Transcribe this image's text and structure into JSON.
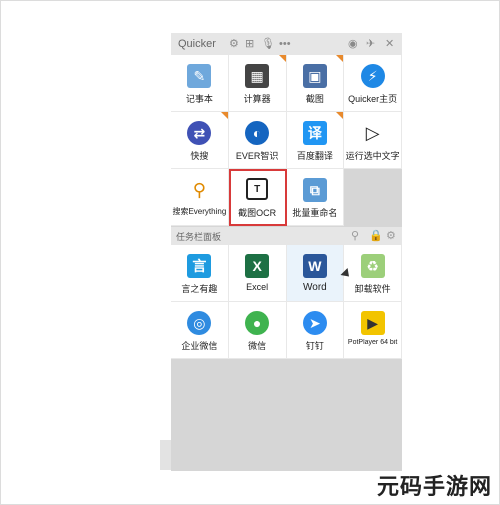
{
  "window": {
    "title": "Quicker",
    "icons": [
      "gear-icon",
      "grid-icon",
      "mic-icon",
      "more-icon",
      "account-icon",
      "pin-icon",
      "close-icon"
    ]
  },
  "actions": [
    {
      "label": "记事本",
      "icon": "notepad-icon",
      "color": "#6fa8dc",
      "corner": false
    },
    {
      "label": "计算器",
      "icon": "calculator-icon",
      "color": "#444444",
      "corner": true
    },
    {
      "label": "截图",
      "icon": "screenshot-icon",
      "color": "#4a6fa5",
      "corner": true
    },
    {
      "label": "Quicker主页",
      "icon": "lightning-icon",
      "color": "#1e88e5",
      "corner": false
    },
    {
      "label": "快搜",
      "icon": "search-arrows-icon",
      "color": "#3f51b5",
      "corner": true
    },
    {
      "label": "EVER智识",
      "icon": "ever-icon",
      "color": "#1565c0",
      "corner": false
    },
    {
      "label": "百度翻译",
      "icon": "translate-icon",
      "color": "#2196f3",
      "corner": true
    },
    {
      "label": "运行选中文字",
      "icon": "play-icon",
      "color": "#222222",
      "corner": false
    },
    {
      "label": "搜索Everything",
      "icon": "magnifier-icon",
      "color": "#e08a00",
      "corner": false
    },
    {
      "label": "截图OCR",
      "icon": "ocr-icon",
      "color": "#222222",
      "corner": false,
      "highlight": true
    },
    {
      "label": "批量重命名",
      "icon": "rename-icon",
      "color": "#5b9bd5",
      "corner": false
    }
  ],
  "taskbar_panel": {
    "title": "任务栏面板",
    "icons": [
      "search-icon",
      "lock-icon",
      "settings-icon"
    ],
    "items": [
      {
        "label": "言之有趣",
        "icon": "yanzhi-icon",
        "color": "#1e9be0"
      },
      {
        "label": "Excel",
        "icon": "excel-icon",
        "color": "#1d7044"
      },
      {
        "label": "Word",
        "icon": "word-icon",
        "color": "#2b579a",
        "hover": true
      },
      {
        "label": "卸载软件",
        "icon": "recycle-icon",
        "color": "#9ccf7a"
      },
      {
        "label": "企业微信",
        "icon": "wecom-icon",
        "color": "#2f8be0"
      },
      {
        "label": "微信",
        "icon": "wechat-icon",
        "color": "#3fb34f"
      },
      {
        "label": "钉钉",
        "icon": "dingtalk-icon",
        "color": "#2d8cf0"
      },
      {
        "label": "PotPlayer 64 bit",
        "icon": "potplayer-icon",
        "color": "#f2c400"
      }
    ]
  },
  "watermark": "元码手游网"
}
